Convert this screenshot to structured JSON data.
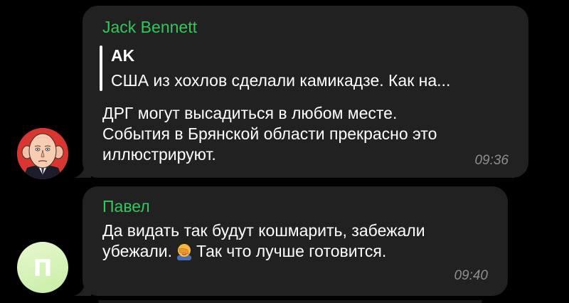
{
  "messages": [
    {
      "sender": "Jack Bennett",
      "reply": {
        "author": "AK",
        "text": "США из хохлов сделали камикадзе. Как на..."
      },
      "text_lines": [
        "ДРГ могут высадиться в любом месте.",
        "События в Брянской области прекрасно это",
        "иллюстрируют."
      ],
      "time": "09:36",
      "avatar": "caricature-portrait"
    },
    {
      "sender": "Павел",
      "text_lines": [
        "Да видать так будут кошмарить, забежали",
        "убежали.",
        "Так что лучше готовится."
      ],
      "emoji": "facepalm-emoji",
      "time": "09:40",
      "avatar_letter": "П"
    }
  ],
  "colors": {
    "background": "#000000",
    "bubble": "#212121",
    "sender_name": "#34c759",
    "text": "#ffffff",
    "time": "#8e8e93",
    "avatar_1": "#d8362f",
    "avatar_2": "#c6eea3"
  }
}
